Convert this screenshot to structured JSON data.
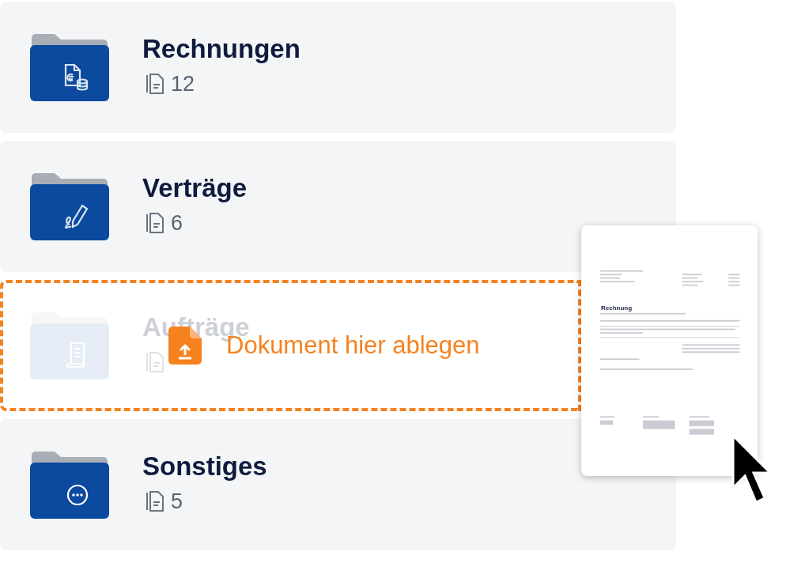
{
  "folders": [
    {
      "kind": "invoice",
      "name": "Rechnungen",
      "count": "12",
      "dimmed": false
    },
    {
      "kind": "contract",
      "name": "Verträge",
      "count": "6",
      "dimmed": false
    },
    {
      "kind": "order",
      "name": "Aufträge",
      "dimmed": true,
      "drop_target": true
    },
    {
      "kind": "other",
      "name": "Sonstiges",
      "count": "5",
      "dimmed": false
    }
  ],
  "drop_zone": {
    "label": "Dokument hier ablegen"
  },
  "dragged_document": {
    "title": "Rechnung"
  }
}
